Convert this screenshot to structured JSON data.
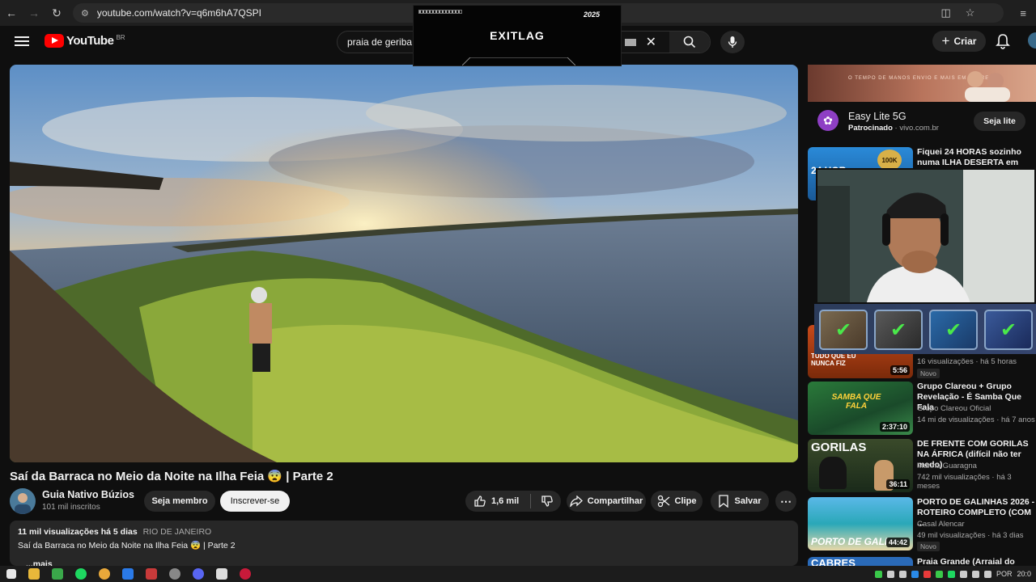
{
  "browser": {
    "url": "youtube.com/watch?v=q6m6hA7QSPI"
  },
  "overlay_ad": {
    "logo": "EXITLAG",
    "badge": "2025"
  },
  "header": {
    "logo_text": "YouTube",
    "region": "BR",
    "search_query": "praia de geriba",
    "create_label": "Criar"
  },
  "video": {
    "title": "Saí da Barraca no Meio da Noite na Ilha Feia 😨 | Parte 2",
    "channel_name": "Guia Nativo Búzios",
    "subscribers": "101 mil inscritos",
    "member_label": "Seja membro",
    "subscribe_label": "Inscrever-se",
    "likes": "1,6 mil",
    "share_label": "Compartilhar",
    "clip_label": "Clipe",
    "save_label": "Salvar"
  },
  "description": {
    "views_date": "11 mil visualizações  há 5 dias",
    "location": "RIO DE JANEIRO",
    "text": "Saí da Barraca no Meio da Noite na Ilha Feia 😨 | Parte 2",
    "more_label": "...mais"
  },
  "sidebar": {
    "ad": {
      "banner_text": "O TEMPO DE MANOS ENVIO\nE MAIS EM ENTREGA",
      "title": "Easy Lite 5G",
      "sponsored": "Patrocinado",
      "domain": "vivo.com.br",
      "cta": "Seja lite"
    },
    "recommendations": [
      {
        "title": "Fiquei 24 HORAS sozinho numa ILHA DESERTA em Búzios - ...",
        "thumb_text": "24 HOR",
        "badge": "100K"
      },
      {
        "thumb_text": "TUDO QUE EU NUNCA FIZ",
        "views": "16 visualizações · há 5 horas",
        "duration": "5:56",
        "badge": "Novo"
      },
      {
        "title": "Grupo Clareou + Grupo Revelação - É Samba Que Fala",
        "channel": "Grupo Clareou Oficial",
        "views": "14 mi de visualizações · há 7 anos",
        "duration": "2:37:10",
        "thumb_text": "SAMBA QUE FALA"
      },
      {
        "title": "DE FRENTE COM GORILAS NA ÁFRICA (difícil não ter medo)",
        "channel": "Marina Guaragna",
        "views": "742 mil visualizações · há 3 meses",
        "duration": "36:11",
        "thumb_text": "GORILAS"
      },
      {
        "title": "PORTO DE GALINHAS 2026 - ROTEIRO COMPLETO (COM ...",
        "channel": "Casal Alencar",
        "views": "49 mil visualizações · há 3 dias",
        "duration": "44:42",
        "thumb_text": "PORTO DE GALI",
        "badge": "Novo"
      },
      {
        "title": "Praia Grande (Arraial do Cabo)",
        "thumb_text": "CABRES"
      }
    ]
  },
  "taskbar": {
    "lang": "POR",
    "time": "20:0"
  },
  "colors": {
    "background": "#0f0f0f",
    "accent": "#ff0000",
    "chip": "#272727"
  }
}
